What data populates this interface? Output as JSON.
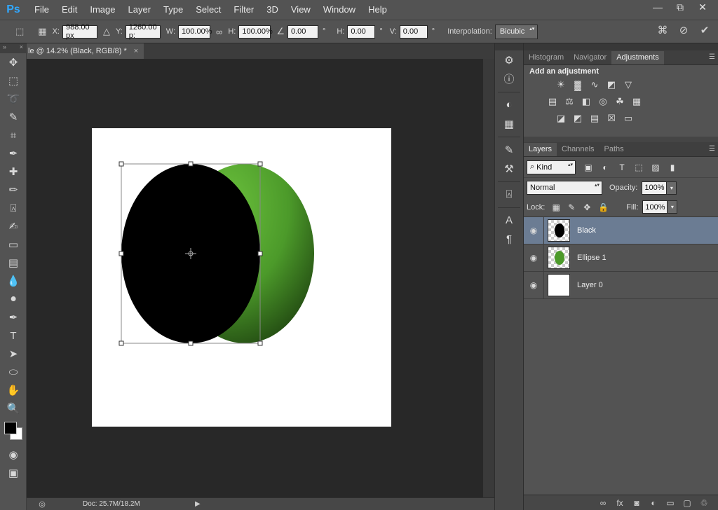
{
  "app": {
    "logo": "Ps"
  },
  "menu": [
    "File",
    "Edit",
    "Image",
    "Layer",
    "Type",
    "Select",
    "Filter",
    "3D",
    "View",
    "Window",
    "Help"
  ],
  "window_controls": {
    "minimize": "—",
    "restore": "⧉",
    "close": "✕"
  },
  "options": {
    "x_label": "X:",
    "x_value": "988.00 px",
    "y_label": "Y:",
    "y_value": "1260.00 p:",
    "w_label": "W:",
    "w_value": "100.00%",
    "h_label": "H:",
    "h_value": "100.00%",
    "angle_value": "0.00",
    "angle_unit": "°",
    "hskew_label": "H:",
    "hskew_value": "0.00",
    "hskew_unit": "°",
    "vskew_label": "V:",
    "vskew_value": "0.00",
    "vskew_unit": "°",
    "interp_label": "Interpolation:",
    "interp_value": "Bicubic"
  },
  "document": {
    "tab_title": "le @ 14.2% (Black, RGB/8) *",
    "tab_close": "×",
    "status_doc": "Doc: 25.7M/18.2M"
  },
  "panels": {
    "top_tabs": [
      "Histogram",
      "Navigator",
      "Adjustments"
    ],
    "adjustments_title": "Add an adjustment",
    "layer_tabs": [
      "Layers",
      "Channels",
      "Paths"
    ],
    "filter_kind": "Kind",
    "blend_mode": "Normal",
    "opacity_label": "Opacity:",
    "opacity_value": "100%",
    "lock_label": "Lock:",
    "fill_label": "Fill:",
    "fill_value": "100%",
    "layers": [
      {
        "name": "Black",
        "selected": true
      },
      {
        "name": "Ellipse 1",
        "selected": false
      },
      {
        "name": "Layer 0",
        "selected": false
      }
    ]
  },
  "colors": {
    "accent_selected": "#6b7c93",
    "ellipse_green": "#4c9a2a",
    "foreground": "#000000",
    "background": "#ffffff"
  }
}
